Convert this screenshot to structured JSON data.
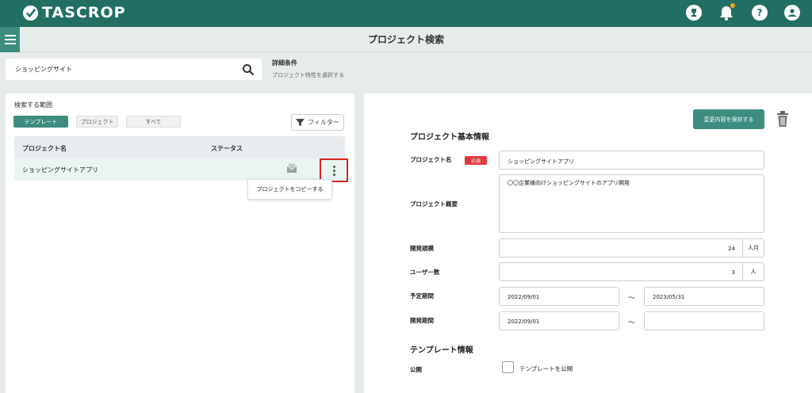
{
  "app": {
    "name": "TASCROP",
    "brand_color": "#226e62",
    "accent_color": "#3c8d80"
  },
  "header": {
    "page_title": "プロジェクト検索",
    "icons": [
      "trophy-icon",
      "bell-icon",
      "help-icon",
      "user-icon"
    ],
    "help_glyph": "?"
  },
  "search": {
    "value": "ショッピングサイト",
    "detail_title": "詳細条件",
    "detail_sub": "プロジェクト特性を選択する"
  },
  "left": {
    "scope_label": "検索する範囲",
    "scope_options": [
      "テンプレート",
      "プロジェクト",
      "すべて"
    ],
    "scope_selected": "テンプレート",
    "filter_label": "フィルター",
    "columns": [
      "プロジェクト名",
      "ステータス"
    ],
    "rows": [
      {
        "name": "ショッピングサイトアプリ"
      }
    ],
    "popup_item": "プロジェクトをコピーする"
  },
  "right": {
    "save_label": "変更内容を保存する",
    "section_basic": "プロジェクト基本情報",
    "label_name": "プロジェクト名",
    "required_badge": "必須",
    "name_value": "ショッピングサイトアプリ",
    "label_summary": "プロジェクト概要",
    "summary_value": "〇〇企業様向けショッピングサイトのアプリ開発",
    "label_scale": "開発規模",
    "scale_value": "24",
    "scale_unit": "人月",
    "label_users": "ユーザー数",
    "users_value": "3",
    "users_unit": "人",
    "label_planned": "予定期間",
    "planned_start": "2022/09/01",
    "planned_end": "2023/05/31",
    "label_dev": "開発期間",
    "dev_start": "2022/09/01",
    "dev_end": "",
    "range_sep": "～",
    "section_template": "テンプレート情報",
    "label_public": "公開",
    "public_checkbox_label": "テンプレートを公開",
    "public_checked": false
  }
}
